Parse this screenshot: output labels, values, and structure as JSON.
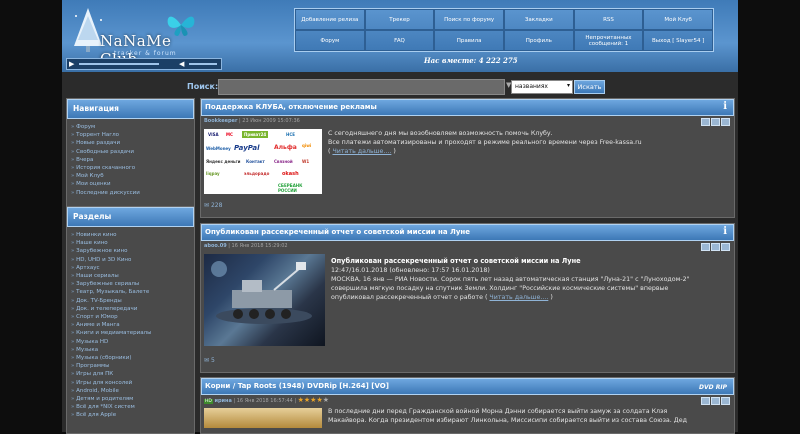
{
  "header": {
    "logo_text": "NaNaMe Club",
    "logo_sub": "tracker & forum",
    "members_label": "Нас вместе: 4 222 275",
    "nav": [
      "Добавление релиза",
      "Трекер",
      "Поиск по форуму",
      "Закладки",
      "RSS",
      "Мой Клуб",
      "Форум",
      "FAQ",
      "Правила",
      "Профиль",
      "Непрочитанных сообщений: 1",
      "Выход [ Slayer54 ]"
    ]
  },
  "search": {
    "label": "Поиск:",
    "marker": "▼",
    "select_value": "названиях",
    "button": "Искать"
  },
  "nav_block": {
    "title": "Навигация",
    "items": [
      "Форум",
      "Торрент Нагло",
      "Новые раздачи",
      "Свободные раздачи",
      "Вчера",
      "История скачанного",
      "Мой Клуб",
      "Мои оценки",
      "Последние дискуссии"
    ]
  },
  "sections_block": {
    "title": "Разделы",
    "items": [
      "Новинки кино",
      "Наше кино",
      "Зарубежное кино",
      "HD, UHD и 3D Кино",
      "Артхаус",
      "Наши сериалы",
      "Зарубежные сериалы",
      "Театр, Музыкаль, Балете",
      "Док. TV-Бренды",
      "Док. и телепередачи",
      "Спорт и Юмор",
      "Аниме и Манга",
      "Книги и медиаматериалы",
      "Музыка HD",
      "Музыка",
      "Музыка (сборники)",
      "Программы",
      "Игры для ПК",
      "Игры для консолей",
      "Android, Mobile",
      "Детям и родителям",
      "Всё для *NIX систем",
      "Всё для Apple"
    ]
  },
  "posts": [
    {
      "title": "Поддержка КЛУБА, отключение рекламы",
      "author": "Bookkeeper",
      "date": "| 23 Июн 2009 15:07:36",
      "text1": "С сегодняшнего дня мы возобновляем возможность помочь Клубу.",
      "text2": "Все платежи автоматизированы и проходят в режиме реального времени через Free-kassa.ru",
      "more": "Читать дальше....",
      "footer": "228",
      "pay_logos": [
        "VISA",
        "MC",
        "Приват24",
        "HCE",
        "WebMoney",
        "PayPal",
        "Альфа",
        "Яндекс деньги",
        "Контакт",
        "Связной",
        "W1",
        "qiwi",
        "liqpay",
        "эльдорадо",
        "okash",
        "СБЕРБАНК РОССИИ"
      ]
    },
    {
      "title": "Опубликован рассекреченный отчет о советской миссии на Луне",
      "author": "aboo.09",
      "date": "| 16 Янв 2018 15:29:02",
      "heading": "Опубликован рассекреченный отчет о советской миссии на Луне",
      "text1": "12:47/16.01.2018 (обновлено: 17:57 16.01.2018)",
      "text2": "МОСКВА, 16 янв — РИА Новости. Сорок пять лет назад автоматическая станция \"Луна-21\" с \"Луноходом-2\"",
      "text3": "совершила мягкую посадку на спутник Земли. Холдинг \"Российские космические системы\" впервые",
      "text4": "опубликовал рассекреченный отчет о работе",
      "more": "Читать дальше....",
      "footer": "5"
    },
    {
      "title": "Корни / Tap Roots (1948) DVDRip [H.264] [VO]",
      "badge": "DVD RIP",
      "tag": "HD",
      "author": "ирина",
      "date": "| 16 Янв 2018 16:57:44 |",
      "stars": "★★★★",
      "star_empty": "★",
      "text1": "В последние дни перед Гражданской войной Морна Дэнни собирается выйти замуж за солдата Клэя",
      "text2": "Макайвора. Когда президентом избирают Линкольна, Миссисипи собирается выйти из состава Союза. Дед"
    }
  ]
}
